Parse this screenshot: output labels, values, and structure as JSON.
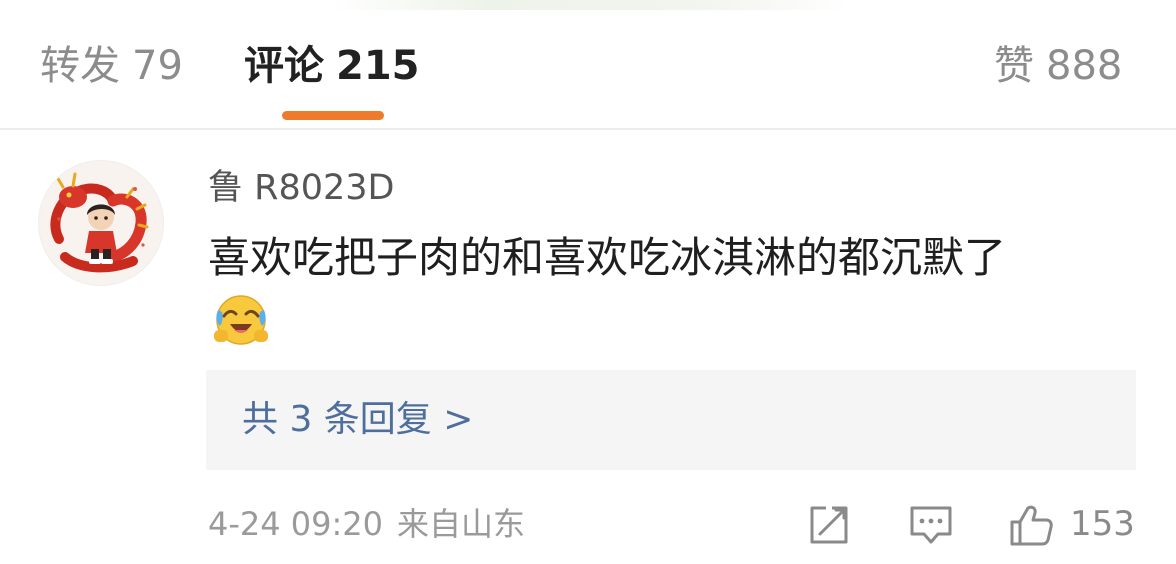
{
  "tabs": {
    "repost": {
      "label": "转发",
      "count": "79"
    },
    "comments": {
      "label": "评论",
      "count": "215"
    },
    "likes": {
      "label": "赞",
      "count": "888"
    },
    "active": "comments"
  },
  "comment": {
    "username": "鲁 R8023D",
    "text": "喜欢吃把子肉的和喜欢吃冰淇淋的都沉默了",
    "emoji": "laughing-crying-emoji",
    "replies_label": "共 3 条回复 >",
    "timestamp": "4-24 09:20",
    "location": "来自山东",
    "like_count": "153"
  },
  "colors": {
    "accent": "#f07a2b",
    "link": "#4e6e9c",
    "reply_box_bg": "#f5f5f5"
  }
}
